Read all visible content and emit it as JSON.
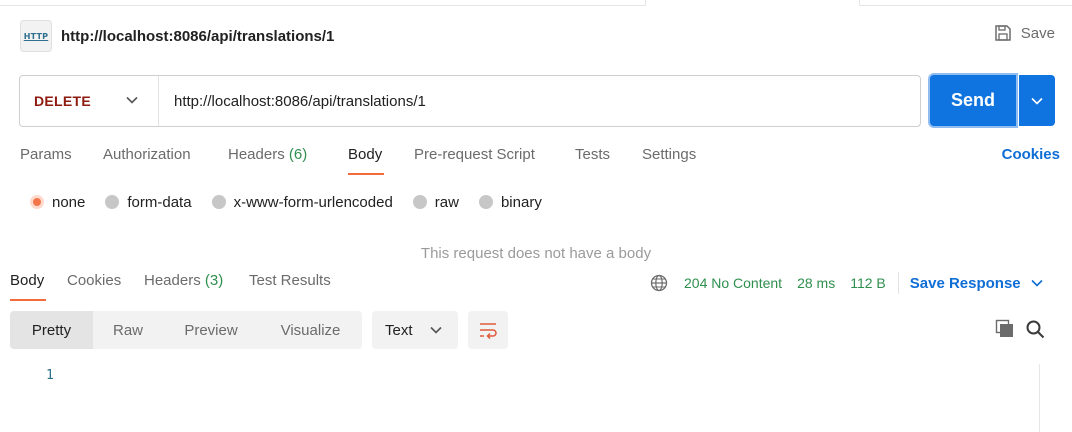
{
  "request": {
    "title": "http://localhost:8086/api/translations/1",
    "icon_label": "HTTP",
    "save_label": "Save",
    "method": "DELETE",
    "url": "http://localhost:8086/api/translations/1",
    "send_label": "Send"
  },
  "request_tabs": {
    "params": "Params",
    "authorization": "Authorization",
    "headers": "Headers",
    "headers_count": "(6)",
    "body": "Body",
    "prerequest": "Pre-request Script",
    "tests": "Tests",
    "settings": "Settings",
    "cookies": "Cookies",
    "active": "Body"
  },
  "body_types": {
    "none": "none",
    "form_data": "form-data",
    "urlencoded": "x-www-form-urlencoded",
    "raw": "raw",
    "binary": "binary",
    "selected": "none"
  },
  "no_body_message": "This request does not have a body",
  "response_tabs": {
    "body": "Body",
    "cookies": "Cookies",
    "headers": "Headers",
    "headers_count": "(3)",
    "test_results": "Test Results",
    "active": "Body"
  },
  "response_meta": {
    "status": "204 No Content",
    "time": "28 ms",
    "size": "112 B",
    "save_response": "Save Response"
  },
  "view_modes": {
    "pretty": "Pretty",
    "raw": "Raw",
    "preview": "Preview",
    "visualize": "Visualize",
    "active": "Pretty"
  },
  "format_select": "Text",
  "editor": {
    "line_numbers": [
      "1"
    ]
  },
  "colors": {
    "accent": "#0f73e0",
    "method_delete": "#8e1a10",
    "active_underline": "#f26b3a",
    "status_ok": "#2f8f4e",
    "link": "#0f6ed6"
  }
}
